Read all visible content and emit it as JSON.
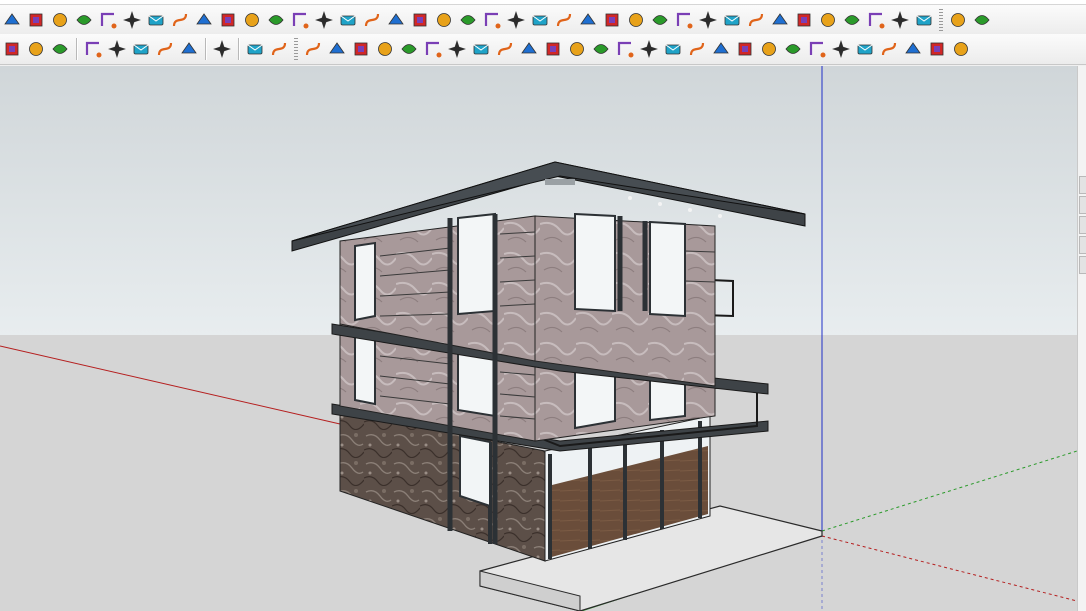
{
  "toolbar_primary": {
    "icons": [
      "section-plane-icon",
      "component-icon",
      "sandbox-icon",
      "layer-icon",
      "material-icon",
      "eraser-icon",
      "rotate-icon",
      "red-square-icon",
      "table-icon",
      "flag-icon",
      "box-open-icon",
      "pipe-icon",
      "fillet-icon",
      "curve-icon",
      "cross-icon",
      "plus-green-icon",
      "x-blue-icon",
      "triangle-icon",
      "flask-icon",
      "warning-icon",
      "arc-icon",
      "arc2-icon",
      "refresh-icon",
      "compass-icon",
      "cylinder-icon",
      "undo-curve-icon",
      "puzzle-icon",
      "cube-out-icon",
      "cube-red-icon",
      "cube-split-icon",
      "gem-icon",
      "dots-icon",
      "frame-icon",
      "grid-orange-icon",
      "grid-yellow-icon",
      "grid-orange2-icon",
      "scatter-icon",
      "dotted-arc-icon",
      "qr-icon",
      "layers-stack-icon",
      "window-tile-icon"
    ]
  },
  "toolbar_secondary": {
    "left_icons": [
      "e-logo-icon",
      "sync-icon",
      "arrows-icon",
      "add-circle-icon",
      "tree-icon",
      "terrain-icon",
      "checker-icon",
      "cloud-upload-icon",
      "gear-icon",
      "mail-icon",
      "info-icon"
    ],
    "tool_icons": [
      "loft-icon",
      "spline-icon",
      "paint-bucket-icon",
      "gear-small-icon",
      "joint-icon",
      "bend-icon",
      "hex-icon",
      "donut-icon",
      "sweep-icon",
      "corner-icon",
      "corner2-icon",
      "slope-icon",
      "arc-cut-icon",
      "house-icon",
      "poly-icon",
      "poly2-icon",
      "grille-icon",
      "grille2-icon",
      "hand-icon",
      "profile-icon",
      "step-icon",
      "stairs-icon",
      "ramp-icon",
      "extrude-icon",
      "extrude2-icon",
      "extrude3-icon",
      "wave-icon",
      "cube-corner-icon"
    ]
  },
  "colors": {
    "sky_top": "#cfd5d8",
    "horizon": "#e6ecee",
    "ground": "#d4d4d4",
    "axis_red": "#b51f1f",
    "axis_green": "#2a9a2a",
    "axis_blue": "#1f2fc8",
    "roof": "#3e4347",
    "stone": "#8a7c7a",
    "marble": "#bfb2b0",
    "glass_frame": "#2c3135",
    "slab": "#e8e8e8",
    "floor_wood": "#5a3a24"
  }
}
